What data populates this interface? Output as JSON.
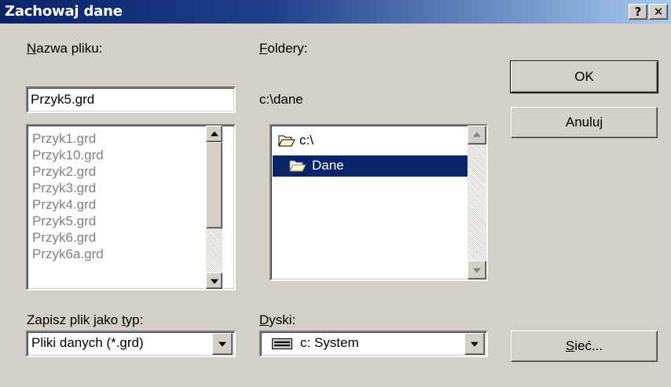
{
  "window": {
    "title": "Zachowaj dane",
    "help_label": "?",
    "close_label": "✕"
  },
  "filename": {
    "label_mnemonic": "N",
    "label_rest": "azwa pliku:",
    "value": "Przyk5.grd"
  },
  "files": [
    "Przyk1.grd",
    "Przyk10.grd",
    "Przyk2.grd",
    "Przyk3.grd",
    "Przyk4.grd",
    "Przyk5.grd",
    "Przyk6.grd",
    "Przyk6a.grd"
  ],
  "folders": {
    "label_mnemonic": "F",
    "label_rest": "oldery:",
    "current_path": "c:\\dane",
    "items": [
      {
        "label": "c:\\",
        "selected": false,
        "icon": "open-folder-icon"
      },
      {
        "label": "Dane",
        "selected": true,
        "icon": "open-folder-icon"
      }
    ]
  },
  "filetype": {
    "label_before": "Zapisz plik jako ",
    "label_mnemonic": "t",
    "label_after": "yp:",
    "value": "Pliki danych (*.grd)"
  },
  "drives": {
    "label_mnemonic": "D",
    "label_rest": "yski:",
    "value": "c: System",
    "icon": "drive-icon"
  },
  "buttons": {
    "ok": "OK",
    "cancel": "Anuluj",
    "network_mnemonic": "S",
    "network_rest": "ieć..."
  },
  "colors": {
    "titlebar_start": "#0a246a",
    "titlebar_end": "#a6caf0",
    "selection": "#0a246a",
    "face": "#d4d0c8"
  }
}
